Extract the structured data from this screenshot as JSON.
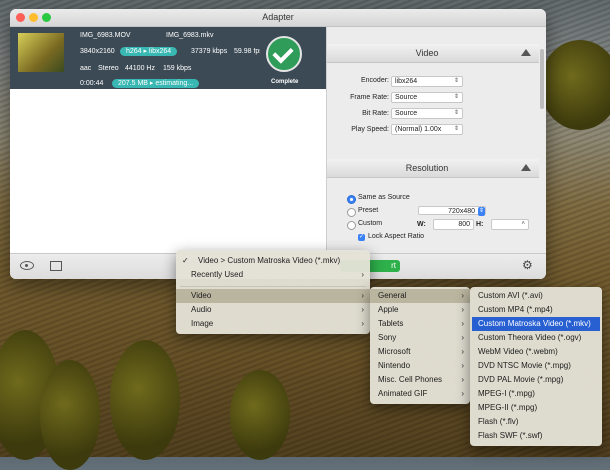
{
  "window": {
    "title": "Adapter",
    "colors": {
      "close": "#fe5f57",
      "minimize": "#febc2e",
      "zoom": "#28c840"
    }
  },
  "file": {
    "input_name": "IMG_6983.MOV",
    "output_name": "IMG_6983.mkv",
    "resolution": "3840x2160",
    "codec_from": "h264",
    "codec_to": "libx264",
    "bitrate": "37379 kbps",
    "fps": "59.98 fps",
    "audio_codec": "aac",
    "audio_channels": "Stereo",
    "audio_rate": "44100 Hz",
    "audio_bitrate": "159 kbps",
    "duration": "0:00:44",
    "size": "207.5 MB",
    "estimate": "estimating...",
    "status": "Complete"
  },
  "video": {
    "header": "Video",
    "encoder_label": "Encoder:",
    "encoder_value": "libx264",
    "framerate_label": "Frame Rate:",
    "framerate_value": "Source",
    "bitrate_label": "Bit Rate:",
    "bitrate_value": "Source",
    "playspeed_label": "Play Speed:",
    "playspeed_value": "(Normal) 1.00x"
  },
  "resolution": {
    "header": "Resolution",
    "same_as_source": "Same as Source",
    "preset_label": "Preset",
    "preset_value": "720x480",
    "custom_label": "Custom",
    "w_label": "W:",
    "w_value": "800",
    "h_label": "H:",
    "h_value": "",
    "lock_label": "Lock Aspect Ratio"
  },
  "bottom": {
    "start_label": "rt"
  },
  "menu1": {
    "current": "Video > Custom Matroska Video (*.mkv)",
    "recently_used": "Recently Used",
    "items": [
      "Video",
      "Audio",
      "Image"
    ]
  },
  "menu2": {
    "items": [
      "General",
      "Apple",
      "Tablets",
      "Sony",
      "Microsoft",
      "Nintendo",
      "Misc. Cell Phones",
      "Animated GIF"
    ]
  },
  "menu3": {
    "items": [
      "Custom AVI (*.avi)",
      "Custom MP4 (*.mp4)",
      "Custom Matroska Video (*.mkv)",
      "Custom Theora Video (*.ogv)",
      "WebM Video (*.webm)",
      "DVD NTSC Movie (*.mpg)",
      "DVD PAL Movie (*.mpg)",
      "MPEG-I (*.mpg)",
      "MPEG-II (*.mpg)",
      "Flash (*.flv)",
      "Flash SWF (*.swf)"
    ]
  }
}
